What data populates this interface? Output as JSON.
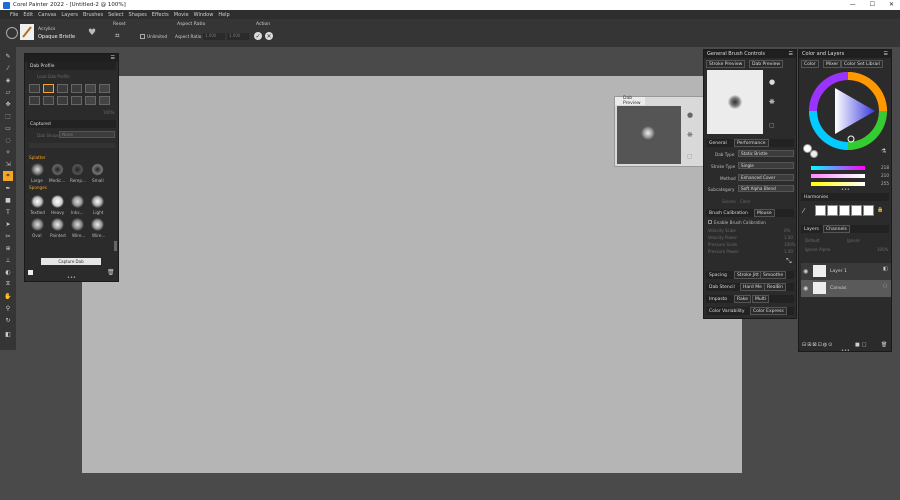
{
  "titlebar": {
    "title": "Corel Painter 2022 - [Untitled-2 @ 100%]",
    "min": "—",
    "max": "☐",
    "close": "✕"
  },
  "menu": [
    "File",
    "Edit",
    "Canvas",
    "Layers",
    "Brushes",
    "Select",
    "Shapes",
    "Effects",
    "Movie",
    "Window",
    "Help"
  ],
  "propbar": {
    "brush_category": "Acrylics",
    "brush_variant": "Opaque Bristle",
    "reset_label": "Reset",
    "aspect_ratio_label": "Aspect Ratio",
    "unlimited_label": "Unlimited",
    "aspect_ratio_field": "Aspect Ratio",
    "width_value": "1.000",
    "height_value": "1.000",
    "action_label": "Action"
  },
  "dab_profile_panel": {
    "title": "Dab Profile",
    "load_profile": "Load Dab Profile",
    "size_val": "100%"
  },
  "captured_panel": {
    "title": "Captured",
    "dab_shape_label": "Dab Shape",
    "dab_shape_value": "None",
    "section_splatter": "Splatter",
    "section_sponges": "Sponges",
    "dab_labels_row1": [
      "Large",
      "Medic...",
      "Remp...",
      "Small"
    ],
    "dab_labels_row2": [
      "Textled",
      "Heavy",
      "Inks...",
      "Light"
    ],
    "dab_labels_row3": [
      "Oval",
      "Painted",
      "Wire...",
      "Wire..."
    ],
    "capture_button": "Capture Dab"
  },
  "dab_preview_float": {
    "title": "Dab Preview"
  },
  "gbc_panel": {
    "title": "General Brush Controls",
    "tab_stroke_preview": "Stroke Preview",
    "tab_dab_preview": "Dab Preview",
    "general_tab": "General",
    "performance_tab": "Performance",
    "dab_type_label": "Dab Type",
    "dab_type_value": "Static Bristle",
    "stroke_type_label": "Stroke Type",
    "stroke_type_value": "Single",
    "method_label": "Method",
    "method_value": "Enhanced Cover",
    "subcategory_label": "Subcategory",
    "subcategory_value": "Soft Alpha Blend",
    "source_label": "Source",
    "source_value": "Color",
    "brush_calibration": "Brush Calibration",
    "mouse_tab": "Mouse",
    "enable_calibration": "Enable Brush Calibration",
    "velocity_scale": "Velocity Scale",
    "velocity_power": "Velocity Power",
    "pressure_scale": "Pressure Scale",
    "pressure_power": "Pressure Power",
    "v1": "0%",
    "v2": "1.00",
    "v3": "100%",
    "v4": "1.00",
    "spacing": "Spacing",
    "stroke_jitter": "Stroke Jitt",
    "smoothing": "Smoothe",
    "dab_stencil": "Dab Stencil",
    "hard_media": "Hard Me",
    "realbristle": "RealBri",
    "impasto": "Impasto",
    "rake": "Rake",
    "multi": "Multi",
    "color_variability": "Color Variability",
    "color_express": "Color Express"
  },
  "color_panel": {
    "title": "Color and Layers",
    "tab_color": "Color",
    "tab_mixer": "Mixer",
    "tab_color_set": "Color Set Librari",
    "r_val": "218",
    "g_val": "210",
    "b_val": "255",
    "harmonies": "Harmonies"
  },
  "layers_panel": {
    "tab_layers": "Layers",
    "tab_channels": "Channels",
    "default_label": "Default",
    "ignore_label": "Ignore",
    "composite_label": "Ignore Alpha",
    "opacity_label": "100%",
    "layer1": "Layer 1",
    "canvas": "Canvas"
  },
  "colors": {
    "canvas": "#b4b5b4",
    "accent": "#f5a623",
    "app_bg": "#4a4a4a",
    "panel": "#2b2b2b"
  }
}
